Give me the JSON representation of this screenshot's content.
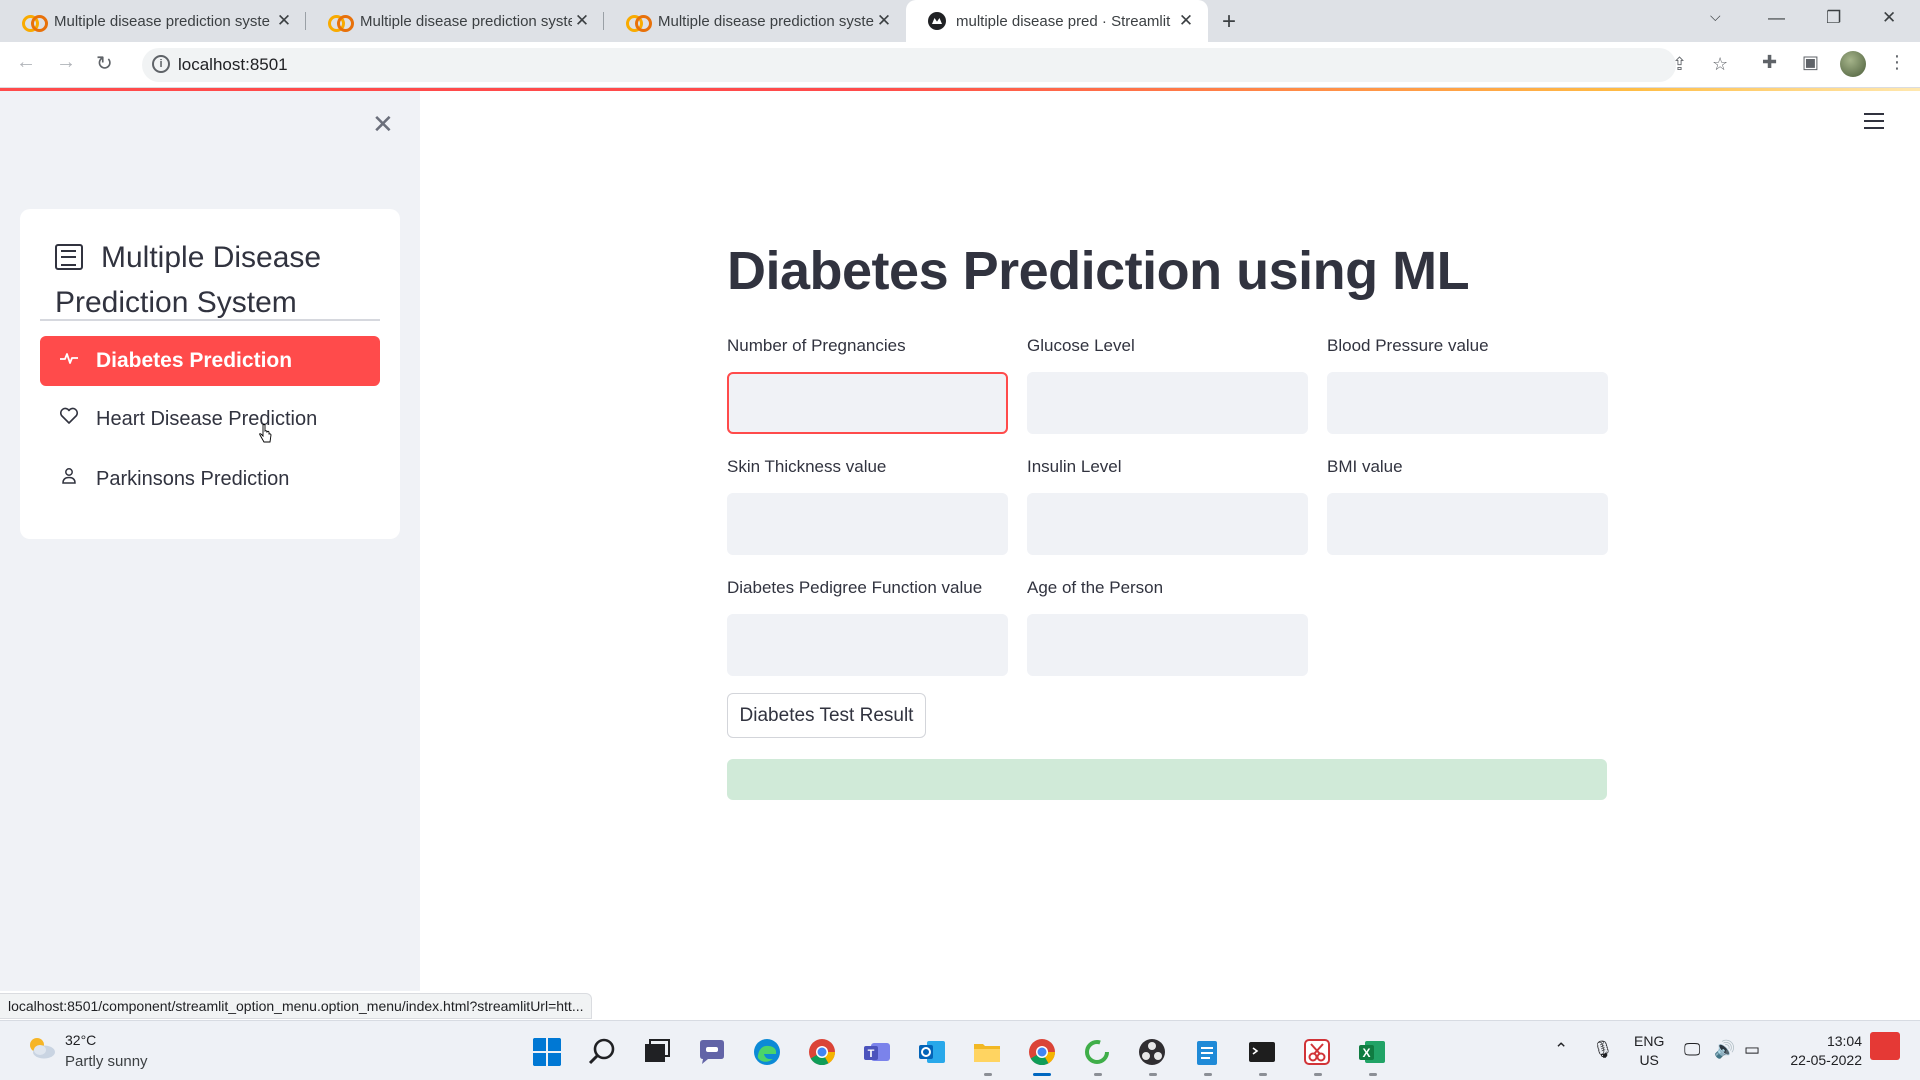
{
  "browser": {
    "tabs": [
      {
        "title": "Multiple disease prediction syste",
        "favicon": "colab-icon",
        "active": false
      },
      {
        "title": "Multiple disease prediction syste",
        "favicon": "colab-icon",
        "active": false
      },
      {
        "title": "Multiple disease prediction syste",
        "favicon": "colab-icon",
        "active": false
      },
      {
        "title": "multiple disease pred · Streamlit",
        "favicon": "streamlit-icon",
        "active": true
      }
    ],
    "url": "localhost:8501",
    "status_url": "localhost:8501/component/streamlit_option_menu.option_menu/index.html?streamlitUrl=htt..."
  },
  "sidebar": {
    "menu_title": "Multiple Disease Prediction System",
    "menu_title_icon": "clipboard-list-icon",
    "items": [
      {
        "label": "Diabetes Prediction",
        "icon": "activity-icon",
        "active": true
      },
      {
        "label": "Heart Disease Prediction",
        "icon": "heart-icon",
        "active": false
      },
      {
        "label": "Parkinsons Prediction",
        "icon": "person-icon",
        "active": false
      }
    ]
  },
  "main": {
    "title": "Diabetes Prediction using ML",
    "fields": [
      {
        "label": "Number of Pregnancies",
        "value": "",
        "focused": true
      },
      {
        "label": "Glucose Level",
        "value": ""
      },
      {
        "label": "Blood Pressure value",
        "value": ""
      },
      {
        "label": "Skin Thickness value",
        "value": ""
      },
      {
        "label": "Insulin Level",
        "value": ""
      },
      {
        "label": "BMI value",
        "value": ""
      },
      {
        "label": "Diabetes Pedigree Function value",
        "value": ""
      },
      {
        "label": "Age of the Person",
        "value": ""
      }
    ],
    "button_label": "Diabetes Test Result",
    "result_text": "",
    "accent_color": "#ff4b4b",
    "success_color": "#d0ead8"
  },
  "taskbar": {
    "weather_temp": "32°C",
    "weather_desc": "Partly sunny",
    "language": "ENG",
    "region": "US",
    "time": "13:04",
    "date": "22-05-2022"
  }
}
